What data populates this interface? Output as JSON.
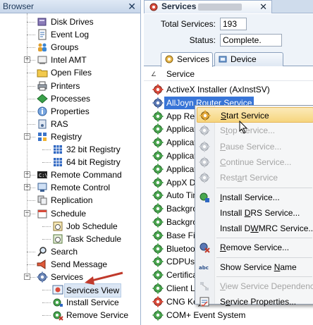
{
  "left_panel": {
    "title": "Browser",
    "close_glyph": "✕",
    "tree": [
      {
        "label": "Disk Drives",
        "icon": "disk-drives-icon",
        "level": 1,
        "expander": ""
      },
      {
        "label": "Event Log",
        "icon": "event-log-icon",
        "level": 1,
        "expander": ""
      },
      {
        "label": "Groups",
        "icon": "groups-icon",
        "level": 1,
        "expander": ""
      },
      {
        "label": "Intel AMT",
        "icon": "intel-amt-icon",
        "level": 1,
        "expander": "+"
      },
      {
        "label": "Open Files",
        "icon": "open-files-icon",
        "level": 1,
        "expander": ""
      },
      {
        "label": "Printers",
        "icon": "printers-icon",
        "level": 1,
        "expander": ""
      },
      {
        "label": "Processes",
        "icon": "processes-icon",
        "level": 1,
        "expander": ""
      },
      {
        "label": "Properties",
        "icon": "properties-icon",
        "level": 1,
        "expander": ""
      },
      {
        "label": "RAS",
        "icon": "ras-icon",
        "level": 1,
        "expander": ""
      },
      {
        "label": "Registry",
        "icon": "registry-icon",
        "level": 1,
        "expander": "-"
      },
      {
        "label": "32 bit Registry",
        "icon": "registry-grid-icon",
        "level": 2,
        "expander": ""
      },
      {
        "label": "64 bit Registry",
        "icon": "registry-grid-icon",
        "level": 2,
        "expander": ""
      },
      {
        "label": "Remote Command",
        "icon": "remote-command-icon",
        "level": 1,
        "expander": "+"
      },
      {
        "label": "Remote Control",
        "icon": "remote-control-icon",
        "level": 1,
        "expander": "+"
      },
      {
        "label": "Replication",
        "icon": "replication-icon",
        "level": 1,
        "expander": ""
      },
      {
        "label": "Schedule",
        "icon": "schedule-icon",
        "level": 1,
        "expander": "-"
      },
      {
        "label": "Job Schedule",
        "icon": "job-schedule-icon",
        "level": 2,
        "expander": ""
      },
      {
        "label": "Task Schedule",
        "icon": "task-schedule-icon",
        "level": 2,
        "expander": ""
      },
      {
        "label": "Search",
        "icon": "search-icon",
        "level": 1,
        "expander": ""
      },
      {
        "label": "Send Message",
        "icon": "send-message-icon",
        "level": 1,
        "expander": ""
      },
      {
        "label": "Services",
        "icon": "services-gear-icon",
        "level": 1,
        "expander": "-"
      },
      {
        "label": "Services View",
        "icon": "services-view-icon",
        "level": 2,
        "expander": "",
        "selected": true
      },
      {
        "label": "Install Service",
        "icon": "install-service-icon",
        "level": 2,
        "expander": ""
      },
      {
        "label": "Remove Service",
        "icon": "remove-service-icon",
        "level": 2,
        "expander": ""
      }
    ]
  },
  "document_tab": {
    "title": "Services",
    "close_glyph": "✕"
  },
  "info": {
    "total_label": "Total Services:",
    "total_value": "193",
    "status_label": "Status:",
    "status_value": "Complete."
  },
  "subtabs": {
    "services": "Services",
    "drivers": "Device Drivers"
  },
  "list": {
    "sort_glyph": "∠",
    "column": "Service",
    "rows": [
      "ActiveX Installer (AxInstSV)",
      "AllJoyn Router Service",
      "App Rea",
      "Applicat",
      "Applicat",
      "Applicat",
      "Applicat",
      "AppX De",
      "Auto Tin",
      "Backgro",
      "Backgro",
      "Base Filt",
      "Bluetoo",
      "CDPUser",
      "Certifica",
      "Client Li",
      "CNG Key Isolation",
      "COM+ Event System"
    ],
    "selected_index": 1
  },
  "context_menu": {
    "items": [
      {
        "label": "Start Service",
        "ul": "S",
        "icon": "start-service-icon",
        "enabled": true,
        "hot": true
      },
      {
        "label": "Stop Service...",
        "ul": "t",
        "icon": "stop-service-icon",
        "enabled": false
      },
      {
        "label": "Pause Service...",
        "ul": "P",
        "icon": "pause-service-icon",
        "enabled": false
      },
      {
        "label": "Continue Service...",
        "ul": "C",
        "icon": "continue-service-icon",
        "enabled": false
      },
      {
        "label": "Restart Service",
        "ul": "a",
        "icon": "restart-service-icon",
        "enabled": false
      },
      {
        "sep": true
      },
      {
        "label": "Install Service...",
        "ul": "I",
        "icon": "install-service-menu-icon",
        "enabled": true
      },
      {
        "label": "Install DRS Service...",
        "ul": "D",
        "icon": "",
        "enabled": true
      },
      {
        "label": "Install DWMRC Service...",
        "ul": "W",
        "icon": "",
        "enabled": true
      },
      {
        "sep": true
      },
      {
        "label": "Remove Service...",
        "ul": "R",
        "icon": "remove-service-menu-icon",
        "enabled": true
      },
      {
        "sep": true
      },
      {
        "label": "Show Service Name",
        "ul": "N",
        "icon": "abc-icon",
        "enabled": true
      },
      {
        "sep": true
      },
      {
        "label": "View Service Dependencies",
        "ul": "V",
        "icon": "dependencies-icon",
        "enabled": false
      },
      {
        "label": "Service Properties...",
        "ul": "e",
        "icon": "properties-menu-icon",
        "enabled": true
      }
    ]
  },
  "colors": {
    "accent": "#3875d7",
    "annotation_arrow": "#c0392b",
    "hot_item": "#f6d57e"
  }
}
